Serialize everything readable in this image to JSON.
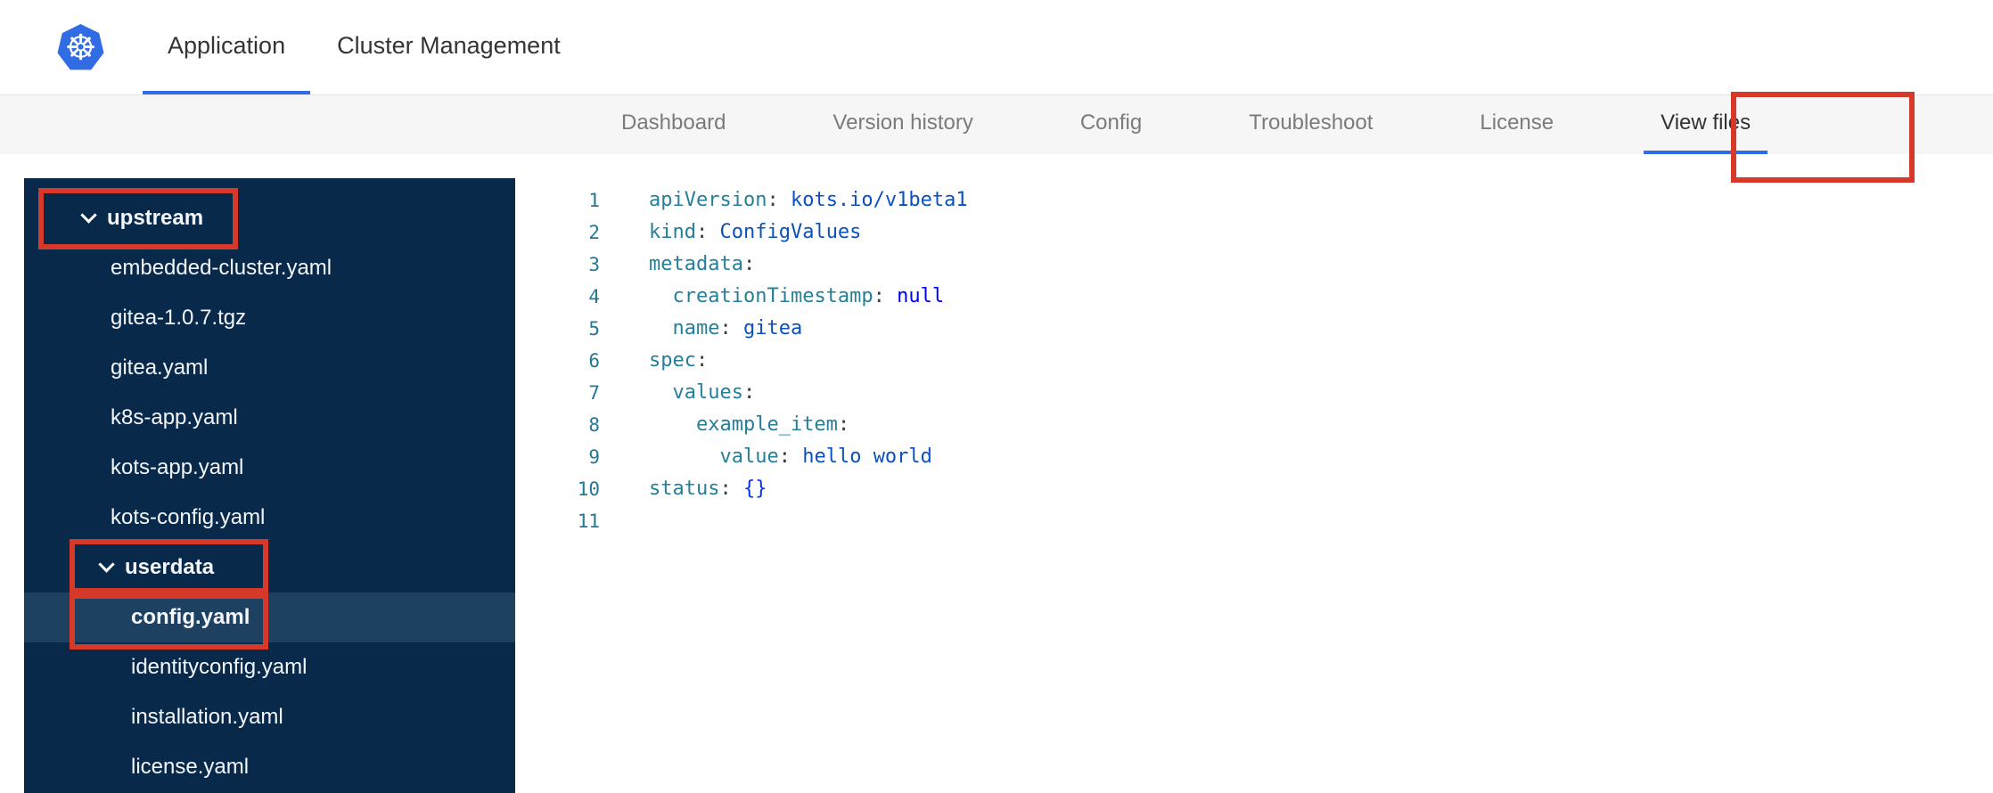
{
  "app": {
    "logo_glyph": "☸"
  },
  "header": {
    "tabs": [
      {
        "label": "Application",
        "active": true
      },
      {
        "label": "Cluster Management",
        "active": false
      }
    ]
  },
  "subnav": {
    "items": [
      {
        "label": "Dashboard",
        "active": false
      },
      {
        "label": "Version history",
        "active": false
      },
      {
        "label": "Config",
        "active": false
      },
      {
        "label": "Troubleshoot",
        "active": false
      },
      {
        "label": "License",
        "active": false
      },
      {
        "label": "View files",
        "active": true
      }
    ]
  },
  "file_tree": {
    "items": [
      {
        "label": "upstream",
        "type": "folder",
        "level": 0,
        "expanded": true
      },
      {
        "label": "embedded-cluster.yaml",
        "type": "file",
        "level": 1
      },
      {
        "label": "gitea-1.0.7.tgz",
        "type": "file",
        "level": 1
      },
      {
        "label": "gitea.yaml",
        "type": "file",
        "level": 1
      },
      {
        "label": "k8s-app.yaml",
        "type": "file",
        "level": 1
      },
      {
        "label": "kots-app.yaml",
        "type": "file",
        "level": 1
      },
      {
        "label": "kots-config.yaml",
        "type": "file",
        "level": 1
      },
      {
        "label": "userdata",
        "type": "folder",
        "level": 1,
        "expanded": true
      },
      {
        "label": "config.yaml",
        "type": "file",
        "level": 2,
        "selected": true
      },
      {
        "label": "identityconfig.yaml",
        "type": "file",
        "level": 2
      },
      {
        "label": "installation.yaml",
        "type": "file",
        "level": 2
      },
      {
        "label": "license.yaml",
        "type": "file",
        "level": 2
      }
    ]
  },
  "editor": {
    "language": "yaml",
    "lines": [
      {
        "num": "1",
        "tokens": [
          {
            "t": "apiVersion",
            "c": "key"
          },
          {
            "t": ": ",
            "c": "punct"
          },
          {
            "t": "kots.io/v1beta1",
            "c": "str"
          }
        ]
      },
      {
        "num": "2",
        "tokens": [
          {
            "t": "kind",
            "c": "key"
          },
          {
            "t": ": ",
            "c": "punct"
          },
          {
            "t": "ConfigValues",
            "c": "str"
          }
        ]
      },
      {
        "num": "3",
        "tokens": [
          {
            "t": "metadata",
            "c": "key"
          },
          {
            "t": ":",
            "c": "punct"
          }
        ]
      },
      {
        "num": "4",
        "tokens": [
          {
            "t": "  ",
            "c": "punct"
          },
          {
            "t": "creationTimestamp",
            "c": "key"
          },
          {
            "t": ": ",
            "c": "punct"
          },
          {
            "t": "null",
            "c": "kw"
          }
        ]
      },
      {
        "num": "5",
        "tokens": [
          {
            "t": "  ",
            "c": "punct"
          },
          {
            "t": "name",
            "c": "key"
          },
          {
            "t": ": ",
            "c": "punct"
          },
          {
            "t": "gitea",
            "c": "str"
          }
        ]
      },
      {
        "num": "6",
        "tokens": [
          {
            "t": "spec",
            "c": "key"
          },
          {
            "t": ":",
            "c": "punct"
          }
        ]
      },
      {
        "num": "7",
        "tokens": [
          {
            "t": "  ",
            "c": "punct"
          },
          {
            "t": "values",
            "c": "key"
          },
          {
            "t": ":",
            "c": "punct"
          }
        ]
      },
      {
        "num": "8",
        "tokens": [
          {
            "t": "    ",
            "c": "punct"
          },
          {
            "t": "example_item",
            "c": "key"
          },
          {
            "t": ":",
            "c": "punct"
          }
        ]
      },
      {
        "num": "9",
        "tokens": [
          {
            "t": "      ",
            "c": "punct"
          },
          {
            "t": "value",
            "c": "key"
          },
          {
            "t": ": ",
            "c": "punct"
          },
          {
            "t": "hello world",
            "c": "str"
          }
        ]
      },
      {
        "num": "10",
        "tokens": [
          {
            "t": "status",
            "c": "key"
          },
          {
            "t": ": ",
            "c": "punct"
          },
          {
            "t": "{}",
            "c": "bracket"
          }
        ]
      },
      {
        "num": "11",
        "tokens": []
      }
    ]
  },
  "annotations": [
    {
      "target": "upstream"
    },
    {
      "target": "view-files"
    },
    {
      "target": "userdata"
    },
    {
      "target": "config.yaml"
    }
  ],
  "colors": {
    "accent_blue": "#326ce5",
    "sidebar_bg": "#09294a",
    "sidebar_selected": "#1e4161",
    "annotation_red": "#d6392a",
    "code_key": "#267f99",
    "code_value": "#0b50bf",
    "code_keyword": "#0000ff",
    "code_bracket": "#0431fa",
    "line_number": "#237893"
  }
}
